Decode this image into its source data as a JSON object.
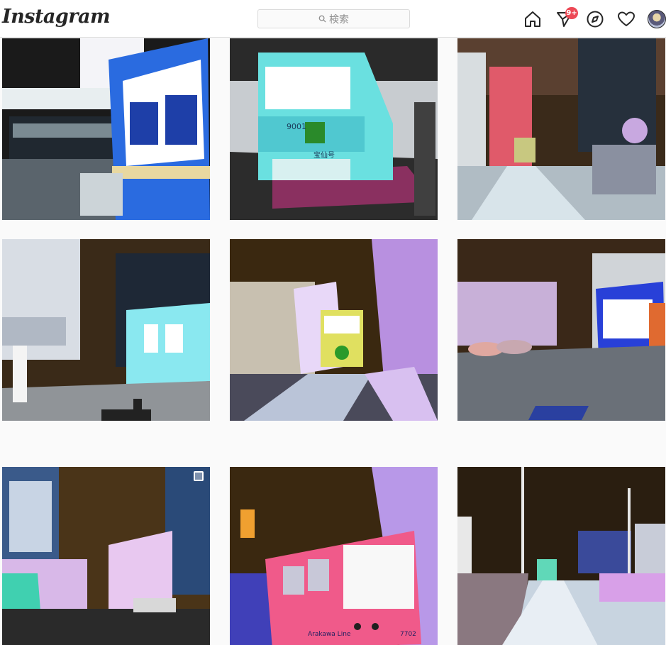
{
  "header": {
    "logo_text": "Instagram",
    "search_placeholder": "検索",
    "nav_icons": [
      "home-icon",
      "direct-message-icon",
      "explore-compass-icon",
      "activity-heart-icon",
      "profile-avatar"
    ],
    "notification_badge": "9+",
    "badge_color": "#ed4956"
  },
  "grid": {
    "posts": [
      {
        "icon": "tram-photo",
        "tram_number": "",
        "tram_sign": ""
      },
      {
        "icon": "tram-photo",
        "tram_number": "9001",
        "tram_sign": "宝仙号"
      },
      {
        "icon": "tram-photo",
        "tram_number": "",
        "tram_sign": ""
      },
      {
        "icon": "tram-photo",
        "tram_number": "",
        "tram_sign": ""
      },
      {
        "icon": "tram-photo",
        "tram_number": "",
        "tram_sign": ""
      },
      {
        "icon": "tram-photo",
        "tram_number": "",
        "tram_sign": ""
      },
      {
        "icon": "tram-photo",
        "tram_number": "",
        "tram_sign": "",
        "multi_photo": true
      },
      {
        "icon": "tram-photo",
        "tram_number": "7702",
        "tram_sign": "Arakawa Line"
      },
      {
        "icon": "tram-photo",
        "tram_number": "",
        "tram_sign": ""
      }
    ]
  }
}
